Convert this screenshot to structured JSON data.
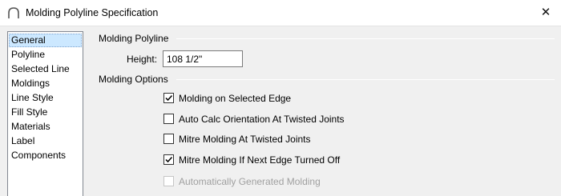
{
  "window": {
    "title": "Molding Polyline Specification",
    "icon": "arch-icon",
    "close_glyph": "✕"
  },
  "sidebar": {
    "items": [
      {
        "label": "General",
        "selected": true
      },
      {
        "label": "Polyline"
      },
      {
        "label": "Selected Line"
      },
      {
        "label": "Moldings"
      },
      {
        "label": "Line Style"
      },
      {
        "label": "Fill Style"
      },
      {
        "label": "Materials"
      },
      {
        "label": "Label"
      },
      {
        "label": "Components"
      }
    ]
  },
  "molding_polyline": {
    "section_title": "Molding Polyline",
    "height_label": "Height:",
    "height_value": "108 1/2\""
  },
  "molding_options": {
    "section_title": "Molding Options",
    "options": [
      {
        "label": "Molding on Selected Edge",
        "checked": true,
        "enabled": true
      },
      {
        "label": "Auto Calc Orientation At Twisted Joints",
        "checked": false,
        "enabled": true
      },
      {
        "label": "Mitre Molding At Twisted Joints",
        "checked": false,
        "enabled": true
      },
      {
        "label": "Mitre Molding If Next Edge Turned Off",
        "checked": true,
        "enabled": true
      },
      {
        "label": "Automatically Generated Molding",
        "checked": false,
        "enabled": false
      }
    ]
  }
}
